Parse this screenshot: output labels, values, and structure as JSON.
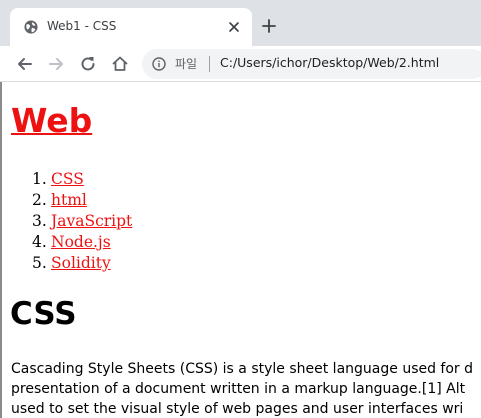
{
  "browser": {
    "tab": {
      "title": "Web1 - CSS"
    },
    "address_bar": {
      "scheme_label": "파일",
      "url": "C:/Users/ichor/Desktop/Web/2.html"
    }
  },
  "page": {
    "site_title": "Web",
    "nav": [
      {
        "num": "1.",
        "label": "CSS"
      },
      {
        "num": "2.",
        "label": "html"
      },
      {
        "num": "3.",
        "label": "JavaScript"
      },
      {
        "num": "4.",
        "label": "Node.js"
      },
      {
        "num": "5.",
        "label": "Solidity"
      }
    ],
    "heading": "CSS",
    "body_lines": [
      "Cascading Style Sheets (CSS) is a style sheet language used for d",
      "presentation of a document written in a markup language.[1] Alt",
      "used to set the visual style of web pages and user interfaces wri"
    ]
  },
  "colors": {
    "link": "#ee1111",
    "tabstrip": "#dee1e6",
    "omnibox": "#f1f3f4"
  }
}
